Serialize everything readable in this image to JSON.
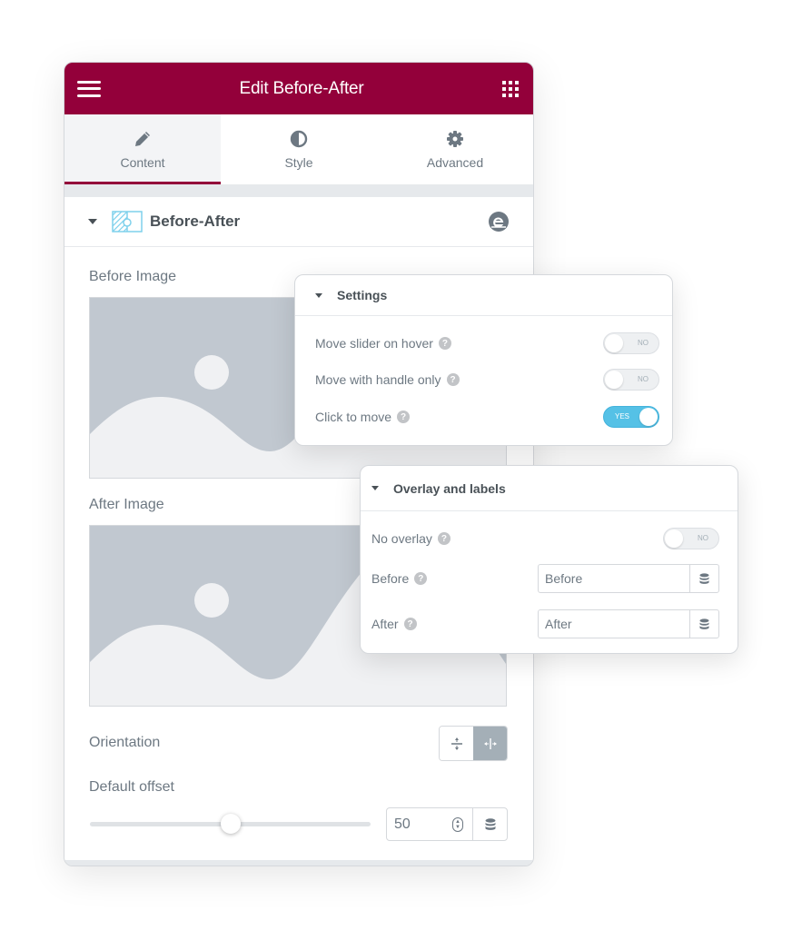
{
  "header": {
    "title": "Edit Before-After",
    "menu_icon": "hamburger-icon",
    "apps_icon": "grid-icon",
    "accent_color": "#93003a"
  },
  "tabs": [
    {
      "label": "Content",
      "icon": "pencil-icon",
      "active": true
    },
    {
      "label": "Style",
      "icon": "half-circle-icon",
      "active": false
    },
    {
      "label": "Advanced",
      "icon": "gear-icon",
      "active": false
    }
  ],
  "section": {
    "title": "Before-After",
    "icon": "before-after-widget-icon",
    "badge_icon": "elementor-pro-icon"
  },
  "fields": {
    "before_image_label": "Before Image",
    "after_image_label": "After Image",
    "orientation_label": "Orientation",
    "orientation_options": [
      {
        "name": "vertical",
        "icon": "vertical-split-icon",
        "active": false
      },
      {
        "name": "horizontal",
        "icon": "horizontal-split-icon",
        "active": true
      }
    ],
    "default_offset_label": "Default offset",
    "default_offset_value": "50",
    "default_offset_fraction": 0.5
  },
  "settings_panel": {
    "title": "Settings",
    "rows": [
      {
        "label": "Move slider on hover",
        "state": "NO",
        "on": false
      },
      {
        "label": "Move with handle only",
        "state": "NO",
        "on": false
      },
      {
        "label": "Click to move",
        "state": "YES",
        "on": true
      }
    ],
    "on_color": "#55c1e6"
  },
  "overlay_panel": {
    "title": "Overlay and labels",
    "no_overlay": {
      "label": "No overlay",
      "state": "NO",
      "on": false
    },
    "before": {
      "label": "Before",
      "value": "Before"
    },
    "after": {
      "label": "After",
      "value": "After"
    }
  }
}
